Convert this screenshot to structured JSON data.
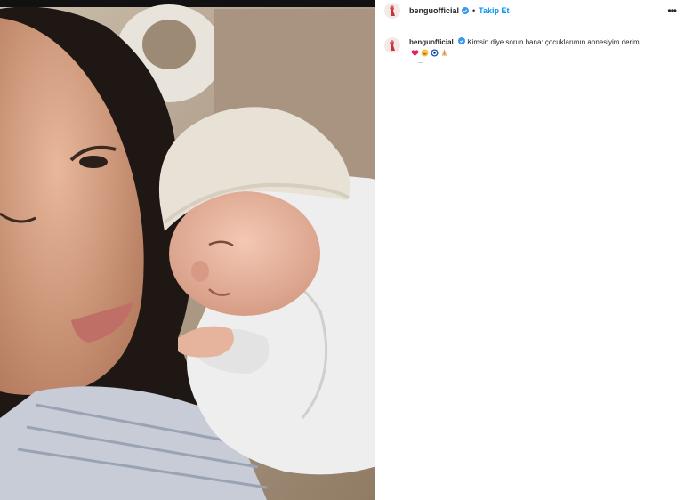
{
  "post": {
    "username": "benguofficial",
    "follow_label": "Takip Et",
    "separator": "•",
    "more_label": "•••",
    "caption_text": "Kimsin diye sorun bana: çocuklarımın annesiyim derim",
    "timestamp": "—",
    "emoji_icons": [
      "red-heart-icon",
      "grinning-with-tears-icon",
      "evil-eye-icon",
      "praying-hands-icon"
    ]
  },
  "colors": {
    "follow_blue": "#0095f6",
    "verified_blue": "#3897f0",
    "text": "#262626",
    "avatar_red": "#c8333a"
  }
}
